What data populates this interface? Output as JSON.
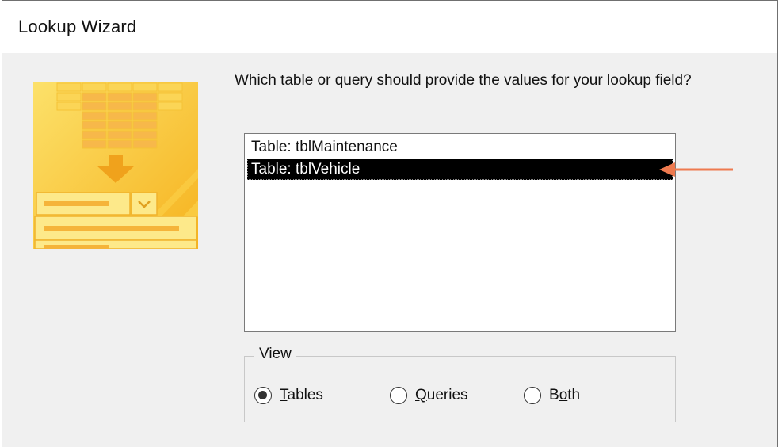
{
  "window": {
    "title": "Lookup Wizard"
  },
  "prompt": "Which table or query should provide the values for your lookup field?",
  "list": {
    "items": [
      {
        "label": "Table: tblMaintenance",
        "selected": false
      },
      {
        "label": "Table: tblVehicle",
        "selected": true
      }
    ]
  },
  "view": {
    "legend": "View",
    "options": [
      {
        "label": "Tables",
        "selected": true
      },
      {
        "label": "Queries",
        "selected": false
      },
      {
        "label": "Both",
        "selected": false
      }
    ]
  },
  "colors": {
    "dialog_bg": "#f0f0f0",
    "selection_bg": "#000000",
    "annotation_arrow": "#ee7a4f",
    "image_yellow": "#f9c233"
  },
  "icons": {
    "wizard_image": "lookup-wizard-illustration-icon",
    "annotation": "arrow-left-icon"
  }
}
